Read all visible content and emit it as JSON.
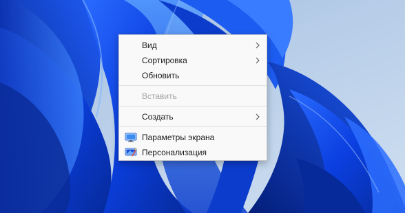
{
  "desktop": {
    "wallpaper_name": "windows-11-bloom",
    "accent_colors": [
      "#0a3ad6",
      "#1b5bff",
      "#062a9a",
      "#3b82f6"
    ]
  },
  "context_menu": {
    "items": [
      {
        "label": "Вид",
        "has_submenu": true,
        "disabled": false
      },
      {
        "label": "Сортировка",
        "has_submenu": true,
        "disabled": false
      },
      {
        "label": "Обновить",
        "has_submenu": false,
        "disabled": false
      },
      {
        "label": "Вставить",
        "has_submenu": false,
        "disabled": true
      },
      {
        "label": "Создать",
        "has_submenu": true,
        "disabled": false
      },
      {
        "label": "Параметры экрана",
        "icon": "display-settings-icon",
        "disabled": false
      },
      {
        "label": "Персонализация",
        "icon": "personalization-icon",
        "disabled": false
      }
    ]
  }
}
